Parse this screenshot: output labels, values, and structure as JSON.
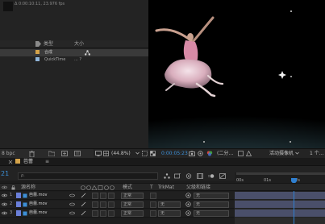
{
  "project_panel": {
    "fps_info": "Δ 0:00:10:11, 23.976 fps",
    "header": {
      "type_label": "类型",
      "size_label": "大小"
    },
    "items": [
      {
        "type": "合成",
        "size": ""
      },
      {
        "type": "QuickTime",
        "size": "... ?"
      }
    ],
    "footer": {
      "bpc_label": "8 bpc"
    }
  },
  "viewer_footer": {
    "zoom": "(44.8%)",
    "timecode": "0:00:05:23",
    "view_mode": "(二分…",
    "camera": "活动摄像机",
    "views": "1 个…"
  },
  "timeline": {
    "tab_label": "芭蕾",
    "current_time": "21",
    "search_placeholder": "ρ.",
    "columns": {
      "source_name": "源名称",
      "mode": "模式",
      "t": "T",
      "trkmat": "TrkMat",
      "parent": "父级和链接"
    },
    "layers": [
      {
        "index": "1",
        "name": "芭蕾.mov",
        "mode": "正常",
        "trkmat": "",
        "parent": "无"
      },
      {
        "index": "2",
        "name": "芭蕾.mov",
        "mode": "正常",
        "trkmat": "无",
        "parent": "无"
      },
      {
        "index": "3",
        "name": "芭蕾.mov",
        "mode": "正常",
        "trkmat": "无",
        "parent": "无"
      }
    ],
    "ruler_labels": [
      "00s",
      "01s",
      "02s"
    ]
  },
  "colors": {
    "accent_blue": "#3c8fd6",
    "playhead": "#2f7fd0",
    "comp_label": "#d4a34a",
    "layer_label": "#6a7fd9"
  }
}
